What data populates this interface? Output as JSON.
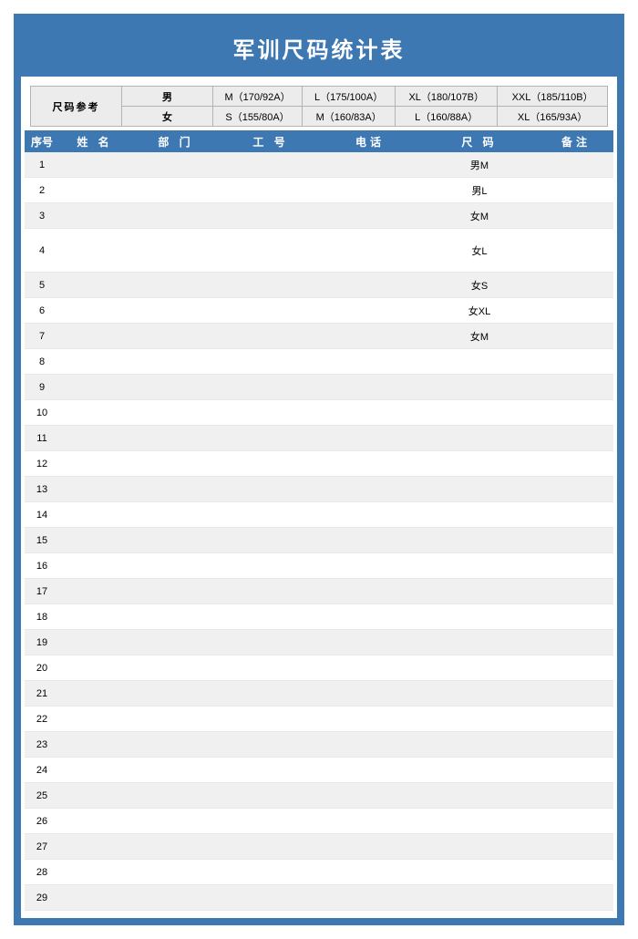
{
  "title": "军训尺码统计表",
  "reference": {
    "label": "尺码参考",
    "rows": [
      {
        "gender": "男",
        "sizes": [
          "M（170/92A）",
          "L（175/100A）",
          "XL（180/107B）",
          "XXL（185/110B）"
        ]
      },
      {
        "gender": "女",
        "sizes": [
          "S（155/80A）",
          "M（160/83A）",
          "L（160/88A）",
          "XL（165/93A）"
        ]
      }
    ]
  },
  "headers": {
    "seq": "序号",
    "name": "姓 名",
    "dept": "部 门",
    "id": "工 号",
    "phone": "电话",
    "size": "尺 码",
    "note": "备注"
  },
  "rows": [
    {
      "seq": "1",
      "name": "",
      "dept": "",
      "id": "",
      "phone": "",
      "size": "男M",
      "note": "",
      "tall": false
    },
    {
      "seq": "2",
      "name": "",
      "dept": "",
      "id": "",
      "phone": "",
      "size": "男L",
      "note": "",
      "tall": false
    },
    {
      "seq": "3",
      "name": "",
      "dept": "",
      "id": "",
      "phone": "",
      "size": "女M",
      "note": "",
      "tall": false
    },
    {
      "seq": "4",
      "name": "",
      "dept": "",
      "id": "",
      "phone": "",
      "size": "女L",
      "note": "",
      "tall": true
    },
    {
      "seq": "5",
      "name": "",
      "dept": "",
      "id": "",
      "phone": "",
      "size": "女S",
      "note": "",
      "tall": false
    },
    {
      "seq": "6",
      "name": "",
      "dept": "",
      "id": "",
      "phone": "",
      "size": "女XL",
      "note": "",
      "tall": false
    },
    {
      "seq": "7",
      "name": "",
      "dept": "",
      "id": "",
      "phone": "",
      "size": "女M",
      "note": "",
      "tall": false
    },
    {
      "seq": "8",
      "name": "",
      "dept": "",
      "id": "",
      "phone": "",
      "size": "",
      "note": "",
      "tall": false
    },
    {
      "seq": "9",
      "name": "",
      "dept": "",
      "id": "",
      "phone": "",
      "size": "",
      "note": "",
      "tall": false
    },
    {
      "seq": "10",
      "name": "",
      "dept": "",
      "id": "",
      "phone": "",
      "size": "",
      "note": "",
      "tall": false
    },
    {
      "seq": "11",
      "name": "",
      "dept": "",
      "id": "",
      "phone": "",
      "size": "",
      "note": "",
      "tall": false
    },
    {
      "seq": "12",
      "name": "",
      "dept": "",
      "id": "",
      "phone": "",
      "size": "",
      "note": "",
      "tall": false
    },
    {
      "seq": "13",
      "name": "",
      "dept": "",
      "id": "",
      "phone": "",
      "size": "",
      "note": "",
      "tall": false
    },
    {
      "seq": "14",
      "name": "",
      "dept": "",
      "id": "",
      "phone": "",
      "size": "",
      "note": "",
      "tall": false
    },
    {
      "seq": "15",
      "name": "",
      "dept": "",
      "id": "",
      "phone": "",
      "size": "",
      "note": "",
      "tall": false
    },
    {
      "seq": "16",
      "name": "",
      "dept": "",
      "id": "",
      "phone": "",
      "size": "",
      "note": "",
      "tall": false
    },
    {
      "seq": "17",
      "name": "",
      "dept": "",
      "id": "",
      "phone": "",
      "size": "",
      "note": "",
      "tall": false
    },
    {
      "seq": "18",
      "name": "",
      "dept": "",
      "id": "",
      "phone": "",
      "size": "",
      "note": "",
      "tall": false
    },
    {
      "seq": "19",
      "name": "",
      "dept": "",
      "id": "",
      "phone": "",
      "size": "",
      "note": "",
      "tall": false
    },
    {
      "seq": "20",
      "name": "",
      "dept": "",
      "id": "",
      "phone": "",
      "size": "",
      "note": "",
      "tall": false
    },
    {
      "seq": "21",
      "name": "",
      "dept": "",
      "id": "",
      "phone": "",
      "size": "",
      "note": "",
      "tall": false
    },
    {
      "seq": "22",
      "name": "",
      "dept": "",
      "id": "",
      "phone": "",
      "size": "",
      "note": "",
      "tall": false
    },
    {
      "seq": "23",
      "name": "",
      "dept": "",
      "id": "",
      "phone": "",
      "size": "",
      "note": "",
      "tall": false
    },
    {
      "seq": "24",
      "name": "",
      "dept": "",
      "id": "",
      "phone": "",
      "size": "",
      "note": "",
      "tall": false
    },
    {
      "seq": "25",
      "name": "",
      "dept": "",
      "id": "",
      "phone": "",
      "size": "",
      "note": "",
      "tall": false
    },
    {
      "seq": "26",
      "name": "",
      "dept": "",
      "id": "",
      "phone": "",
      "size": "",
      "note": "",
      "tall": false
    },
    {
      "seq": "27",
      "name": "",
      "dept": "",
      "id": "",
      "phone": "",
      "size": "",
      "note": "",
      "tall": false
    },
    {
      "seq": "28",
      "name": "",
      "dept": "",
      "id": "",
      "phone": "",
      "size": "",
      "note": "",
      "tall": false
    },
    {
      "seq": "29",
      "name": "",
      "dept": "",
      "id": "",
      "phone": "",
      "size": "",
      "note": "",
      "tall": false
    }
  ]
}
